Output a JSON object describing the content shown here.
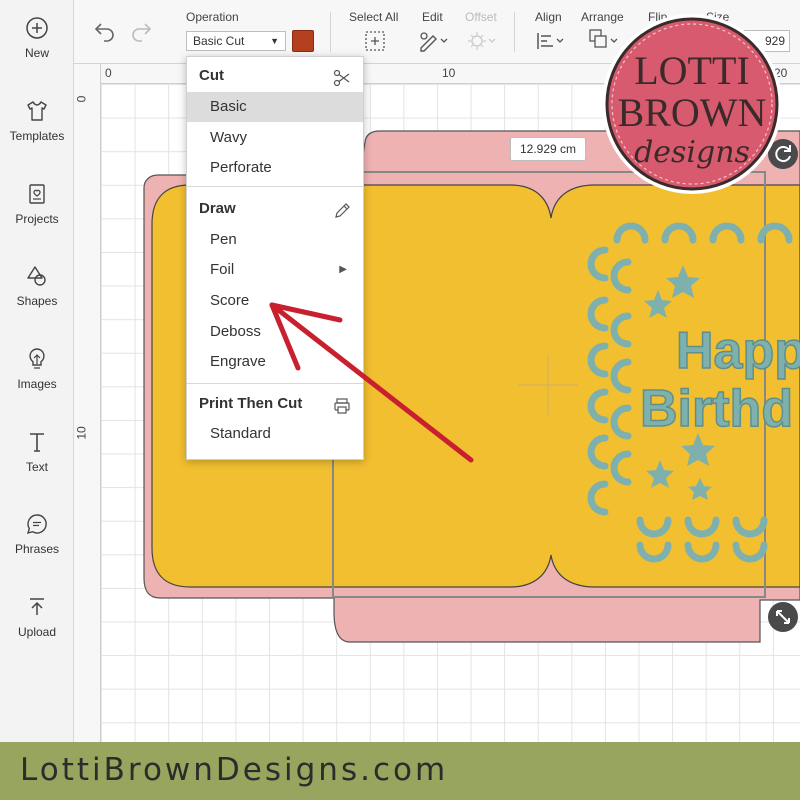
{
  "sidebar": {
    "items": [
      {
        "label": "New",
        "icon": "plus-circle-icon"
      },
      {
        "label": "Templates",
        "icon": "shirt-icon"
      },
      {
        "label": "Projects",
        "icon": "projects-icon"
      },
      {
        "label": "Shapes",
        "icon": "shapes-icon"
      },
      {
        "label": "Images",
        "icon": "lightbulb-icon"
      },
      {
        "label": "Text",
        "icon": "text-icon"
      },
      {
        "label": "Phrases",
        "icon": "speech-bubble-icon"
      },
      {
        "label": "Upload",
        "icon": "upload-icon"
      }
    ]
  },
  "toolbar": {
    "operation_label": "Operation",
    "operation_value": "Basic Cut",
    "operation_color": "#b5401f",
    "select_all_label": "Select All",
    "edit_label": "Edit",
    "offset_label": "Offset",
    "align_label": "Align",
    "arrange_label": "Arrange",
    "flip_label": "Flip",
    "size_label": "Size",
    "size_value": "929"
  },
  "ruler": {
    "top_ticks": [
      "0",
      "10",
      "20"
    ],
    "left_ticks": [
      "0",
      "10"
    ]
  },
  "canvas": {
    "dimension_tag": "12.929 cm",
    "card_text_line1": "Happ",
    "card_text_line2": "Birthd",
    "colors": {
      "card_yellow": "#f2bf30",
      "envelope_pink": "#efb2b2",
      "decoration_teal": "#7eb1ad"
    }
  },
  "menu": {
    "cut_header": "Cut",
    "cut_items": [
      "Basic",
      "Wavy",
      "Perforate"
    ],
    "active_item": "Basic",
    "draw_header": "Draw",
    "draw_items": [
      "Pen",
      "Foil",
      "Score",
      "Deboss",
      "Engrave"
    ],
    "print_header": "Print Then Cut",
    "print_items": [
      "Standard"
    ]
  },
  "logo": {
    "line1": "LOTTI",
    "line2": "BROWN",
    "line3": "designs"
  },
  "footer": {
    "text": "LottiBrownDesigns.com"
  },
  "accent": {
    "arrow_color": "#c8202e"
  }
}
